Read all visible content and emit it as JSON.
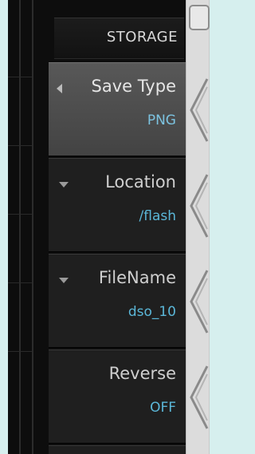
{
  "panel": {
    "title": "STORAGE",
    "items": [
      {
        "label": "Save Type",
        "value": "PNG",
        "selected": true,
        "arrow": "left"
      },
      {
        "label": "Location",
        "value": "/flash",
        "selected": false,
        "arrow": "down"
      },
      {
        "label": "FileName",
        "value": "dso_10",
        "selected": false,
        "arrow": "down"
      },
      {
        "label": "Reverse",
        "value": "OFF",
        "selected": false,
        "arrow": "none"
      }
    ]
  },
  "colors": {
    "background": "#d6efee",
    "panel": "#0d0d0d",
    "item": "#1f1f1f",
    "item_selected": "#4d4d4d",
    "value_text": "#5bb7d8",
    "label_text": "#cfcfcf"
  },
  "icons": {
    "left_arrow": "left-triangle-icon",
    "down_arrow": "down-triangle-icon",
    "softkey": "chevron-softkey-icon"
  }
}
